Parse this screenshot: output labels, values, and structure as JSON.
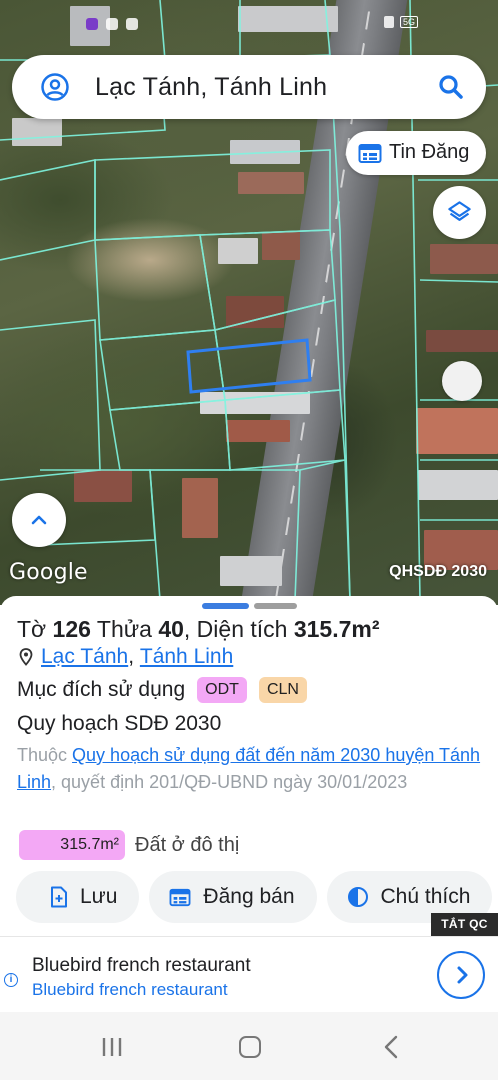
{
  "search": {
    "query": "Lạc Tánh, Tánh Linh"
  },
  "map": {
    "tin_dang_label": "Tin Đăng",
    "google_logo": "Google",
    "layer_badge": "QHSDĐ 2030",
    "icons": [
      "account-circle-icon",
      "search-icon",
      "calendar-list-icon",
      "layers-icon",
      "chevron-up-icon"
    ]
  },
  "parcel": {
    "to_label": "Tờ",
    "to_number": "126",
    "thua_label": "Thửa",
    "thua_number": "40",
    "area_label": ", Diện tích",
    "area_value": "315.7m²",
    "location_commune": "Lạc Tánh",
    "location_sep": ",",
    "location_district": "Tánh Linh",
    "purpose_label": "Mục đích sử dụng",
    "purpose_chips": [
      "ODT",
      "CLN"
    ],
    "plan_title": "Quy hoạch SDĐ 2030",
    "desc_prefix": "Thuộc",
    "desc_link": "Quy hoạch sử dụng đất đến năm 2030 huyện Tánh Linh",
    "desc_suffix": ", quyết định 201/QĐ-UBND ngày 30/01/2023",
    "area_chip": "315.7m²",
    "area_chip_label": "Đất ở đô thị"
  },
  "actions": {
    "save": "Lưu",
    "post_sale": "Đăng bán",
    "legend": "Chú thích"
  },
  "ad": {
    "hide_label": "TẮT QC",
    "title": "Bluebird french restaurant",
    "subtitle": "Bluebird french restaurant",
    "info_glyph": "i"
  },
  "status": {
    "lte": "5G"
  },
  "colors": {
    "accent": "#1a73e8",
    "odt_chip": "#f3a8f5",
    "cln_chip": "#f9d6a8",
    "parcel_outline": "#2f7ff0",
    "cadastral_lines": "#7ff5e0"
  }
}
